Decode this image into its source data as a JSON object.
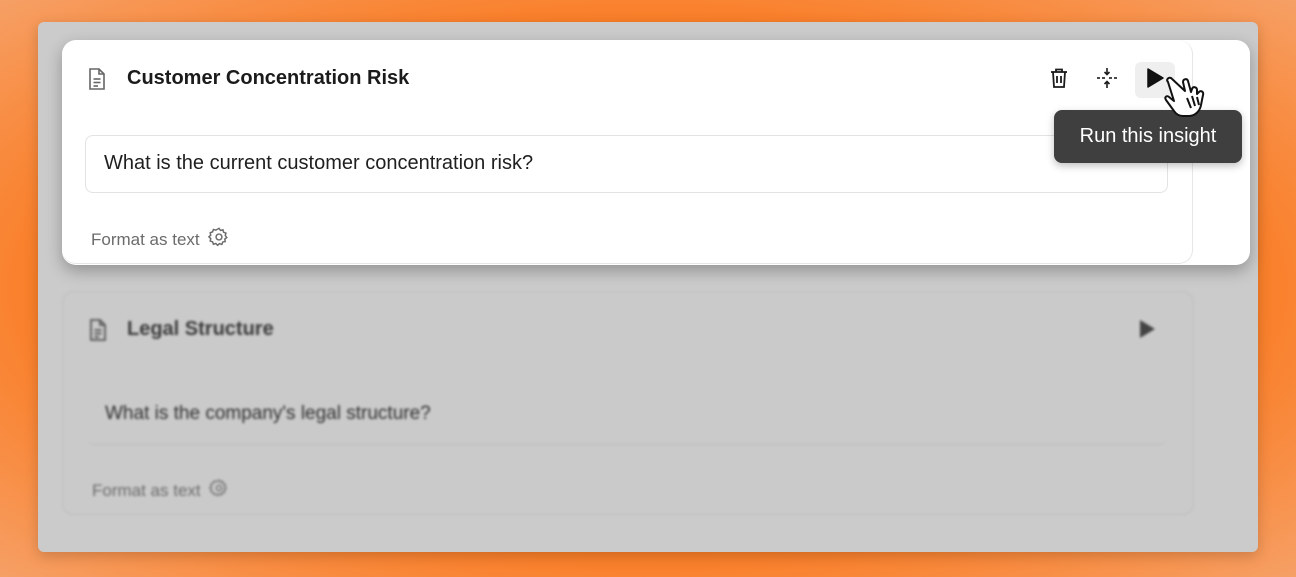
{
  "cards": [
    {
      "title": "Customer Concentration Risk",
      "question": "What is the current customer concentration risk?",
      "format_label": "Format as text",
      "actions": [
        "trash-icon",
        "collapse-icon",
        "play-icon"
      ]
    },
    {
      "title": "Legal Structure",
      "question": "What is the company's legal structure?",
      "format_label": "Format as text",
      "actions": [
        "play-icon"
      ]
    }
  ],
  "tooltip": {
    "text": "Run this insight"
  },
  "colors": {
    "background_orange": "#fb7415",
    "panel_gray": "#cbcbcb",
    "tooltip_bg": "#3f3f3f"
  }
}
